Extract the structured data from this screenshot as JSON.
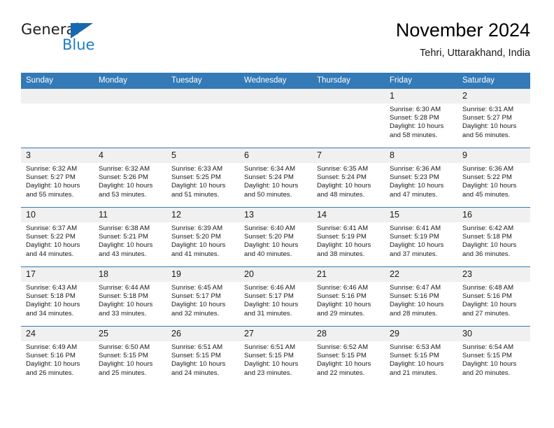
{
  "brand": {
    "line1": "General",
    "line2": "Blue",
    "logo_icon": "triangle-icon",
    "accent_color": "#1668b0"
  },
  "header": {
    "title": "November 2024",
    "subtitle": "Tehri, Uttarakhand, India"
  },
  "theme": {
    "header_bg": "#337ab7",
    "daynum_bg": "#f0f0f0",
    "text": "#1a1a1a"
  },
  "calendar": {
    "weekday_headers": [
      "Sunday",
      "Monday",
      "Tuesday",
      "Wednesday",
      "Thursday",
      "Friday",
      "Saturday"
    ],
    "weeks": [
      [
        {
          "day": "",
          "empty": true
        },
        {
          "day": "",
          "empty": true
        },
        {
          "day": "",
          "empty": true
        },
        {
          "day": "",
          "empty": true
        },
        {
          "day": "",
          "empty": true
        },
        {
          "day": "1",
          "sunrise": "Sunrise: 6:30 AM",
          "sunset": "Sunset: 5:28 PM",
          "daylight": "Daylight: 10 hours and 58 minutes."
        },
        {
          "day": "2",
          "sunrise": "Sunrise: 6:31 AM",
          "sunset": "Sunset: 5:27 PM",
          "daylight": "Daylight: 10 hours and 56 minutes."
        }
      ],
      [
        {
          "day": "3",
          "sunrise": "Sunrise: 6:32 AM",
          "sunset": "Sunset: 5:27 PM",
          "daylight": "Daylight: 10 hours and 55 minutes."
        },
        {
          "day": "4",
          "sunrise": "Sunrise: 6:32 AM",
          "sunset": "Sunset: 5:26 PM",
          "daylight": "Daylight: 10 hours and 53 minutes."
        },
        {
          "day": "5",
          "sunrise": "Sunrise: 6:33 AM",
          "sunset": "Sunset: 5:25 PM",
          "daylight": "Daylight: 10 hours and 51 minutes."
        },
        {
          "day": "6",
          "sunrise": "Sunrise: 6:34 AM",
          "sunset": "Sunset: 5:24 PM",
          "daylight": "Daylight: 10 hours and 50 minutes."
        },
        {
          "day": "7",
          "sunrise": "Sunrise: 6:35 AM",
          "sunset": "Sunset: 5:24 PM",
          "daylight": "Daylight: 10 hours and 48 minutes."
        },
        {
          "day": "8",
          "sunrise": "Sunrise: 6:36 AM",
          "sunset": "Sunset: 5:23 PM",
          "daylight": "Daylight: 10 hours and 47 minutes."
        },
        {
          "day": "9",
          "sunrise": "Sunrise: 6:36 AM",
          "sunset": "Sunset: 5:22 PM",
          "daylight": "Daylight: 10 hours and 45 minutes."
        }
      ],
      [
        {
          "day": "10",
          "sunrise": "Sunrise: 6:37 AM",
          "sunset": "Sunset: 5:22 PM",
          "daylight": "Daylight: 10 hours and 44 minutes."
        },
        {
          "day": "11",
          "sunrise": "Sunrise: 6:38 AM",
          "sunset": "Sunset: 5:21 PM",
          "daylight": "Daylight: 10 hours and 43 minutes."
        },
        {
          "day": "12",
          "sunrise": "Sunrise: 6:39 AM",
          "sunset": "Sunset: 5:20 PM",
          "daylight": "Daylight: 10 hours and 41 minutes."
        },
        {
          "day": "13",
          "sunrise": "Sunrise: 6:40 AM",
          "sunset": "Sunset: 5:20 PM",
          "daylight": "Daylight: 10 hours and 40 minutes."
        },
        {
          "day": "14",
          "sunrise": "Sunrise: 6:41 AM",
          "sunset": "Sunset: 5:19 PM",
          "daylight": "Daylight: 10 hours and 38 minutes."
        },
        {
          "day": "15",
          "sunrise": "Sunrise: 6:41 AM",
          "sunset": "Sunset: 5:19 PM",
          "daylight": "Daylight: 10 hours and 37 minutes."
        },
        {
          "day": "16",
          "sunrise": "Sunrise: 6:42 AM",
          "sunset": "Sunset: 5:18 PM",
          "daylight": "Daylight: 10 hours and 36 minutes."
        }
      ],
      [
        {
          "day": "17",
          "sunrise": "Sunrise: 6:43 AM",
          "sunset": "Sunset: 5:18 PM",
          "daylight": "Daylight: 10 hours and 34 minutes."
        },
        {
          "day": "18",
          "sunrise": "Sunrise: 6:44 AM",
          "sunset": "Sunset: 5:18 PM",
          "daylight": "Daylight: 10 hours and 33 minutes."
        },
        {
          "day": "19",
          "sunrise": "Sunrise: 6:45 AM",
          "sunset": "Sunset: 5:17 PM",
          "daylight": "Daylight: 10 hours and 32 minutes."
        },
        {
          "day": "20",
          "sunrise": "Sunrise: 6:46 AM",
          "sunset": "Sunset: 5:17 PM",
          "daylight": "Daylight: 10 hours and 31 minutes."
        },
        {
          "day": "21",
          "sunrise": "Sunrise: 6:46 AM",
          "sunset": "Sunset: 5:16 PM",
          "daylight": "Daylight: 10 hours and 29 minutes."
        },
        {
          "day": "22",
          "sunrise": "Sunrise: 6:47 AM",
          "sunset": "Sunset: 5:16 PM",
          "daylight": "Daylight: 10 hours and 28 minutes."
        },
        {
          "day": "23",
          "sunrise": "Sunrise: 6:48 AM",
          "sunset": "Sunset: 5:16 PM",
          "daylight": "Daylight: 10 hours and 27 minutes."
        }
      ],
      [
        {
          "day": "24",
          "sunrise": "Sunrise: 6:49 AM",
          "sunset": "Sunset: 5:16 PM",
          "daylight": "Daylight: 10 hours and 26 minutes."
        },
        {
          "day": "25",
          "sunrise": "Sunrise: 6:50 AM",
          "sunset": "Sunset: 5:15 PM",
          "daylight": "Daylight: 10 hours and 25 minutes."
        },
        {
          "day": "26",
          "sunrise": "Sunrise: 6:51 AM",
          "sunset": "Sunset: 5:15 PM",
          "daylight": "Daylight: 10 hours and 24 minutes."
        },
        {
          "day": "27",
          "sunrise": "Sunrise: 6:51 AM",
          "sunset": "Sunset: 5:15 PM",
          "daylight": "Daylight: 10 hours and 23 minutes."
        },
        {
          "day": "28",
          "sunrise": "Sunrise: 6:52 AM",
          "sunset": "Sunset: 5:15 PM",
          "daylight": "Daylight: 10 hours and 22 minutes."
        },
        {
          "day": "29",
          "sunrise": "Sunrise: 6:53 AM",
          "sunset": "Sunset: 5:15 PM",
          "daylight": "Daylight: 10 hours and 21 minutes."
        },
        {
          "day": "30",
          "sunrise": "Sunrise: 6:54 AM",
          "sunset": "Sunset: 5:15 PM",
          "daylight": "Daylight: 10 hours and 20 minutes."
        }
      ]
    ]
  }
}
